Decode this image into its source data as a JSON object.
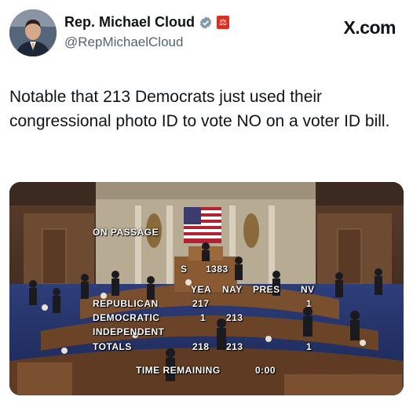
{
  "author": {
    "name": "Rep. Michael Cloud",
    "handle": "@RepMichaelCloud",
    "verified_icon": "verified-badge-icon",
    "affiliation_icon": "house-seal-icon"
  },
  "brand": {
    "logo_text": "X.com"
  },
  "tweet": {
    "text": "Notable that 213 Democrats just used their congressional photo ID to vote NO on a voter ID bill."
  },
  "media": {
    "board": {
      "heading": "ON PASSAGE",
      "s_label": "S",
      "s_value": "1383",
      "col_yea": "YEA",
      "col_nay": "NAY",
      "col_pres": "PRES",
      "col_nv": "NV",
      "rows": [
        {
          "party": "REPUBLICAN",
          "yea": "217",
          "nay": "",
          "nv": "1"
        },
        {
          "party": "DEMOCRATIC",
          "yea": "1",
          "nay": "213",
          "nv": ""
        },
        {
          "party": "INDEPENDENT",
          "yea": "",
          "nay": "",
          "nv": ""
        },
        {
          "party": "TOTALS",
          "yea": "218",
          "nay": "213",
          "nv": "1"
        }
      ],
      "time_label": "TIME REMAINING",
      "time_value": "0:00"
    }
  },
  "colors": {
    "text_primary": "#0f1419",
    "text_secondary": "#536471",
    "verified": "#829aab",
    "badge_red": "#d93025"
  }
}
